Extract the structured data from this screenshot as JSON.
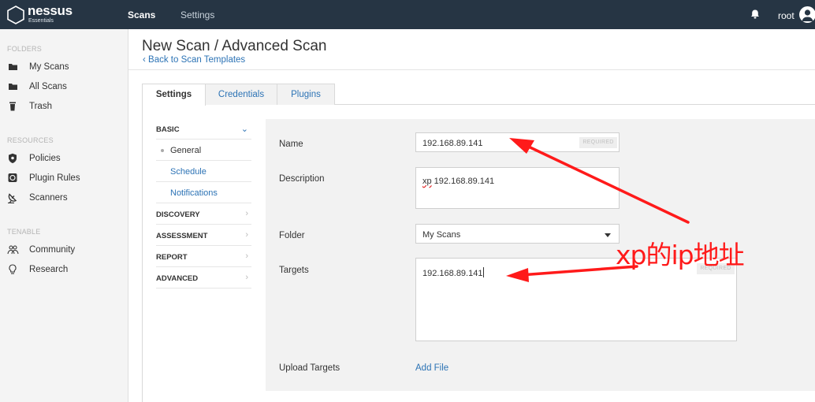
{
  "brand": {
    "name": "nessus",
    "edition": "Essentials"
  },
  "topnav": {
    "scans": "Scans",
    "settings": "Settings",
    "user": "root"
  },
  "sidebar": {
    "folders_heading": "FOLDERS",
    "folders": [
      {
        "label": "My Scans",
        "icon": "folder-icon"
      },
      {
        "label": "All Scans",
        "icon": "folder-icon"
      },
      {
        "label": "Trash",
        "icon": "trash-icon"
      }
    ],
    "resources_heading": "RESOURCES",
    "resources": [
      {
        "label": "Policies",
        "icon": "shield-icon"
      },
      {
        "label": "Plugin Rules",
        "icon": "plugin-rules-icon"
      },
      {
        "label": "Scanners",
        "icon": "satellite-dish-icon"
      }
    ],
    "tenable_heading": "TENABLE",
    "tenable": [
      {
        "label": "Community",
        "icon": "community-icon"
      },
      {
        "label": "Research",
        "icon": "lightbulb-icon"
      }
    ]
  },
  "page": {
    "title": "New Scan / Advanced Scan",
    "back_link": "‹ Back to Scan Templates"
  },
  "tabs": [
    "Settings",
    "Credentials",
    "Plugins"
  ],
  "settings_menu": {
    "basic": "BASIC",
    "basic_items": [
      "General",
      "Schedule",
      "Notifications"
    ],
    "discovery": "DISCOVERY",
    "assessment": "ASSESSMENT",
    "report": "REPORT",
    "advanced": "ADVANCED"
  },
  "form": {
    "name_label": "Name",
    "name_value": "192.168.89.141",
    "required_badge": "REQUIRED",
    "description_label": "Description",
    "description_prefix": "xp",
    "description_rest": " 192.168.89.141",
    "folder_label": "Folder",
    "folder_value": "My Scans",
    "targets_label": "Targets",
    "targets_value": "192.168.89.141",
    "upload_label": "Upload Targets",
    "add_file": "Add File"
  },
  "annotation": {
    "text": "xp的ip地址",
    "color": "#ff1a1a"
  },
  "colors": {
    "topbar": "#263544",
    "link": "#2c73b5",
    "panel": "#f2f2f2"
  }
}
